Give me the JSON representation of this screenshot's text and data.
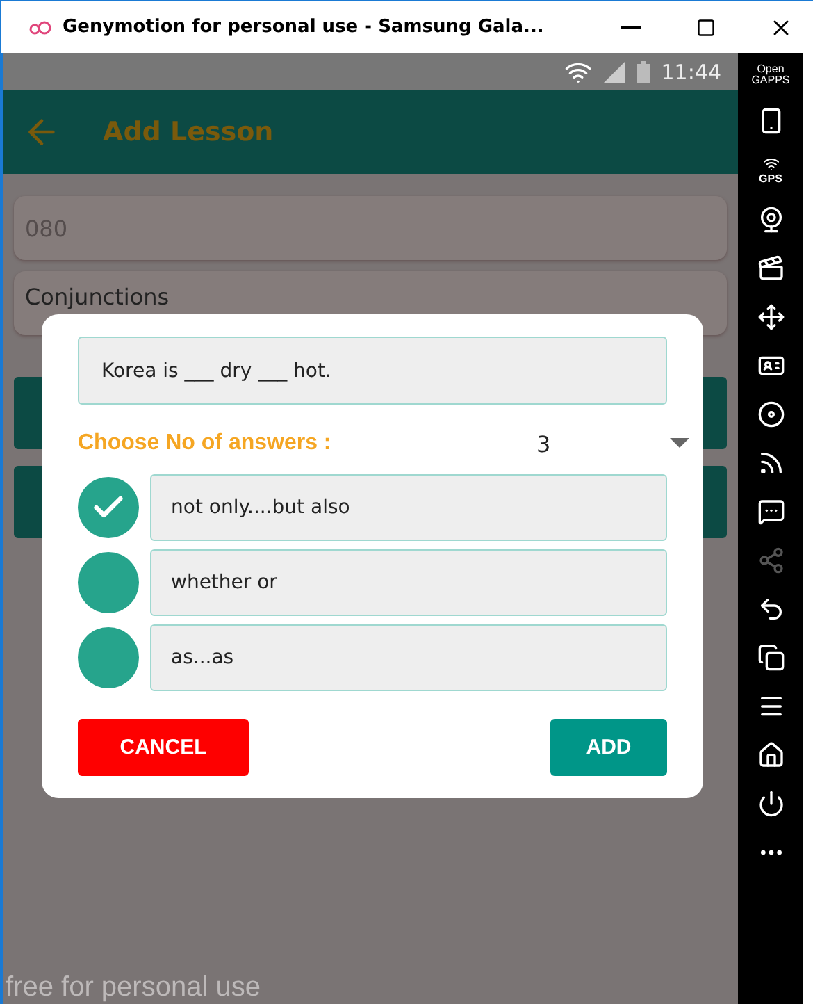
{
  "window": {
    "title": "Genymotion for personal use - Samsung Gala..."
  },
  "status_bar": {
    "time": "11:44"
  },
  "toolbar": {
    "title": "Add Lesson"
  },
  "form": {
    "fields": [
      {
        "placeholder": "080"
      },
      {
        "value": "Conjunctions"
      }
    ]
  },
  "dialog": {
    "question": "Korea is ___ dry ___ hot.",
    "answers_label": "Choose No of answers :",
    "answer_count": "3",
    "answers": [
      {
        "text": "not only....but also",
        "checked": true
      },
      {
        "text": "whether or",
        "checked": false
      },
      {
        "text": "as...as",
        "checked": false
      }
    ],
    "cancel": "CANCEL",
    "add": "ADD"
  },
  "overlay_text": "free for personal use",
  "sidebar": {
    "logo_lines": [
      "Open",
      "GAPPS"
    ],
    "gps_label": "GPS"
  }
}
